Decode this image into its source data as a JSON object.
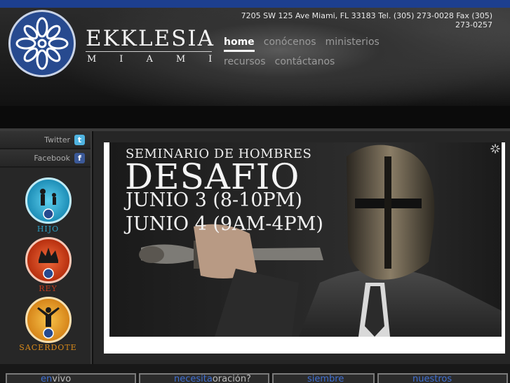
{
  "brand": {
    "name": "EKKLESIA",
    "city": "MIAMI"
  },
  "header": {
    "address": "7205 SW 125 Ave Miami, FL 33183 Tel. (305) 273-0028 Fax (305) 273-0257"
  },
  "nav": [
    {
      "label": "home",
      "active": true
    },
    {
      "label": "conócenos"
    },
    {
      "label": "ministerios"
    },
    {
      "label": "recursos"
    },
    {
      "label": "contáctanos"
    }
  ],
  "sidebar": {
    "social": [
      {
        "label": "Twitter",
        "icon": "twitter-icon",
        "glyph": "t"
      },
      {
        "label": "Facebook",
        "icon": "facebook-icon",
        "glyph": "f"
      }
    ],
    "badges": [
      {
        "label": "HIJO",
        "color": "#2a9fc4",
        "text_color": "#2a9fc4"
      },
      {
        "label": "REY",
        "color": "#c23a1c",
        "text_color": "#c23a1c"
      },
      {
        "label": "SACERDOTE",
        "color": "#d98a1a",
        "text_color": "#d98a1a"
      }
    ]
  },
  "banner": {
    "pre": "SEMINARIO DE HOMBRES",
    "title": "DESAFIO",
    "line1": "JUNIO 3 (8-10PM)",
    "line2": "JUNIO 4 (9AM-4PM)"
  },
  "bottom_tabs": [
    {
      "blue": "en",
      "gray": "vivo"
    },
    {
      "blue": "necesita",
      "gray": "oración?"
    },
    {
      "blue": "siembre",
      "gray": ""
    },
    {
      "blue": "nuestros",
      "gray": ""
    }
  ],
  "colors": {
    "accent_blue": "#274a8f",
    "top_strip": "#1d3f8f",
    "link_blue": "#3f6fd1"
  }
}
